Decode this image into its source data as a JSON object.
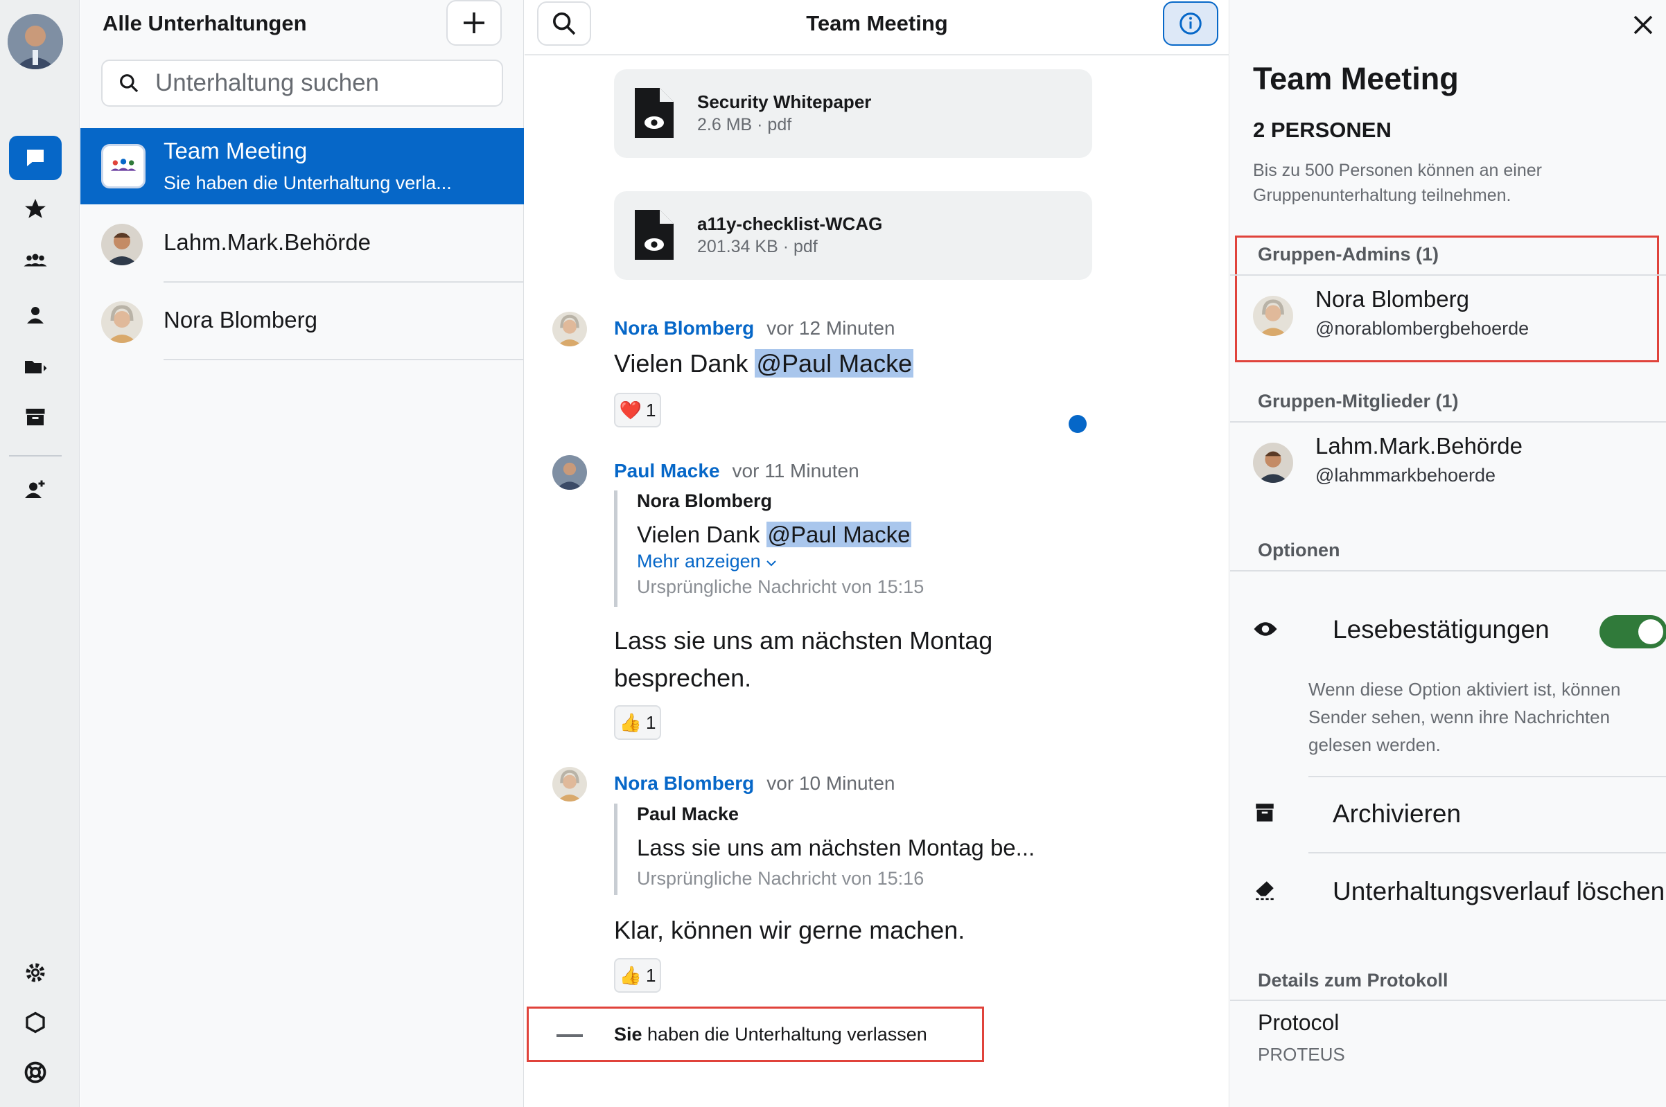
{
  "rail": {
    "items": [
      "conversations-icon",
      "favorites-icon",
      "groups-icon",
      "people-icon",
      "folders-icon",
      "archive-icon",
      "add-contact-icon"
    ],
    "bottom": [
      "settings-icon",
      "hexagon-icon",
      "support-icon"
    ]
  },
  "list": {
    "title": "Alle Unterhaltungen",
    "search_placeholder": "Unterhaltung suchen",
    "conversations": [
      {
        "name": "Team Meeting",
        "subtitle": "Sie haben die Unterhaltung verla..."
      },
      {
        "name": "Lahm.Mark.Behörde"
      },
      {
        "name": "Nora Blomberg"
      }
    ]
  },
  "chat": {
    "title": "Team Meeting",
    "files": [
      {
        "name": "Security Whitepaper",
        "meta": "2.6 MB · pdf"
      },
      {
        "name": "a11y-checklist-WCAG",
        "meta": "201.34 KB · pdf"
      }
    ],
    "messages": [
      {
        "author": "Nora Blomberg",
        "time": "vor 12 Minuten",
        "text_prefix": "Vielen Dank ",
        "mention": "@Paul Macke",
        "reaction": {
          "emoji": "❤️",
          "count": "1"
        }
      },
      {
        "author": "Paul Macke",
        "time": "vor 11 Minuten",
        "quote": {
          "author": "Nora Blomberg",
          "text_prefix": "Vielen Dank ",
          "mention": "@Paul Macke",
          "more": "Mehr anzeigen",
          "orig": "Ursprüngliche Nachricht von 15:15"
        },
        "text": "Lass sie uns am nächsten Montag besprechen.",
        "reaction": {
          "emoji": "👍",
          "count": "1"
        }
      },
      {
        "author": "Nora Blomberg",
        "time": "vor 10 Minuten",
        "quote": {
          "author": "Paul Macke",
          "text": "Lass sie uns am nächsten Montag be...",
          "orig": "Ursprüngliche Nachricht von 15:16"
        },
        "text": "Klar, können wir gerne machen.",
        "reaction": {
          "emoji": "👍",
          "count": "1"
        }
      }
    ],
    "system": {
      "bold": "Sie",
      "rest": " haben die Unterhaltung verlassen"
    }
  },
  "details": {
    "title": "Team Meeting",
    "people_count": "2 PERSONEN",
    "people_info": "Bis zu 500 Personen können an einer Gruppenunterhaltung teilnehmen.",
    "admins_label": "Gruppen-Admins (1)",
    "admin": {
      "name": "Nora Blomberg",
      "handle": "@norablombergbehoerde"
    },
    "members_label": "Gruppen-Mitglieder (1)",
    "member": {
      "name": "Lahm.Mark.Behörde",
      "handle": "@lahmmarkbehoerde"
    },
    "options_label": "Optionen",
    "read_receipts": {
      "label": "Lesebestätigungen",
      "enabled": true,
      "description": "Wenn diese Option aktiviert ist, können Sender sehen, wenn ihre Nachrichten gelesen werden."
    },
    "archive_label": "Archivieren",
    "clear_label": "Unterhaltungsverlauf löschen",
    "protocol_label": "Details zum Protokoll",
    "protocol_name": "Protocol",
    "protocol_value": "PROTEUS"
  },
  "colors": {
    "accent": "#0667c8",
    "highlight_border": "#e0433b",
    "toggle_on": "#307a3a",
    "mention_bg": "#a9c6ec"
  }
}
